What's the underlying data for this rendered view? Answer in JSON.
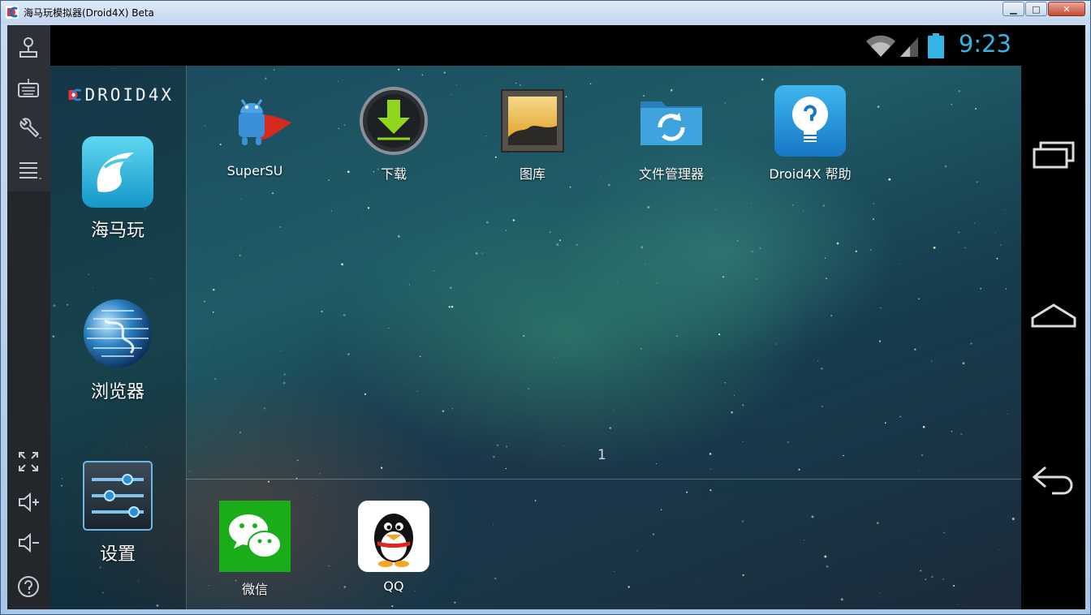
{
  "window": {
    "title": "海马玩模拟器(Droid4X) Beta",
    "min_label": "▁",
    "max_label": "□",
    "close_label": "✕"
  },
  "status_bar": {
    "time": "9:23"
  },
  "brand": {
    "logo_text": "DROID4X"
  },
  "side_apps": [
    {
      "label": "海马玩",
      "icon": "haimawan-icon"
    },
    {
      "label": "浏览器",
      "icon": "browser-globe-icon"
    },
    {
      "label": "设置",
      "icon": "settings-sliders-icon"
    }
  ],
  "desktop_apps": [
    {
      "label": "SuperSU",
      "icon": "supersu-icon"
    },
    {
      "label": "下载",
      "icon": "download-icon"
    },
    {
      "label": "图库",
      "icon": "gallery-icon"
    },
    {
      "label": "文件管理器",
      "icon": "folder-sync-icon"
    },
    {
      "label": "Droid4X 帮助",
      "icon": "help-bulb-icon"
    }
  ],
  "page_indicator": "1",
  "dock_apps": [
    {
      "label": "微信",
      "icon": "wechat-icon"
    },
    {
      "label": "QQ",
      "icon": "qq-penguin-icon"
    }
  ],
  "toolbar": [
    {
      "name": "joystick-icon"
    },
    {
      "name": "keyboard-icon"
    },
    {
      "name": "wrench-icon"
    },
    {
      "name": "menu-list-icon"
    },
    {
      "name": "fullscreen-icon"
    },
    {
      "name": "volume-up-icon"
    },
    {
      "name": "volume-down-icon"
    },
    {
      "name": "help-icon"
    }
  ],
  "navbar": [
    {
      "name": "recent-apps-icon"
    },
    {
      "name": "home-icon"
    },
    {
      "name": "back-icon"
    }
  ],
  "colors": {
    "clock": "#33b5e5",
    "wechat": "#1aad19",
    "help_tile": "#1e90d6"
  }
}
